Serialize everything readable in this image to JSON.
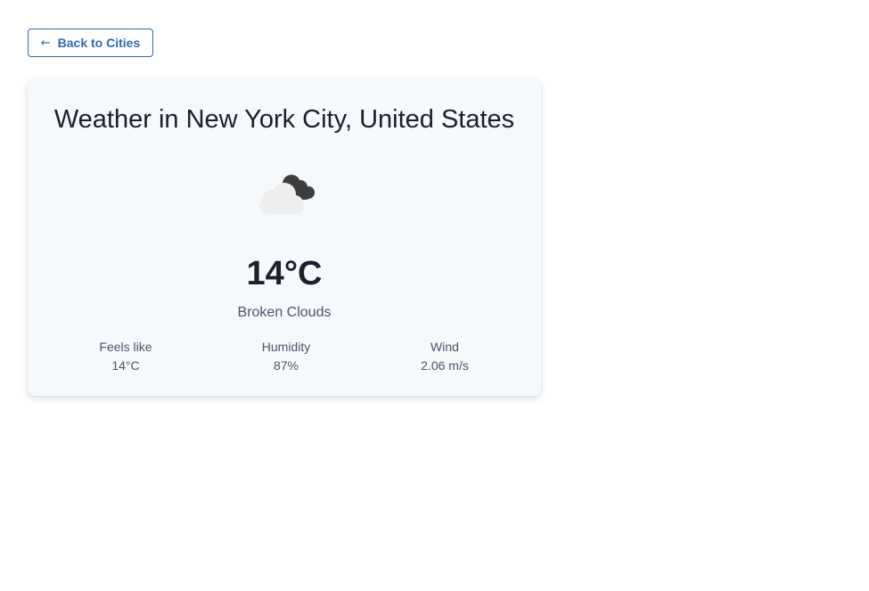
{
  "navigation": {
    "back_label": "Back to Cities",
    "back_icon": "arrow-left-icon"
  },
  "weather": {
    "title": "Weather in New York City, United States",
    "icon": "broken-clouds-icon",
    "temperature": "14°C",
    "description": "Broken Clouds",
    "stats": {
      "feels_like": {
        "label": "Feels like",
        "value": "14°C"
      },
      "humidity": {
        "label": "Humidity",
        "value": "87%"
      },
      "wind": {
        "label": "Wind",
        "value": "2.06 m/s"
      }
    }
  },
  "colors": {
    "accent": "#2b6cb0",
    "card_background": "#f6f9fc",
    "text_primary": "#1a202c",
    "text_secondary": "#4a5568"
  }
}
